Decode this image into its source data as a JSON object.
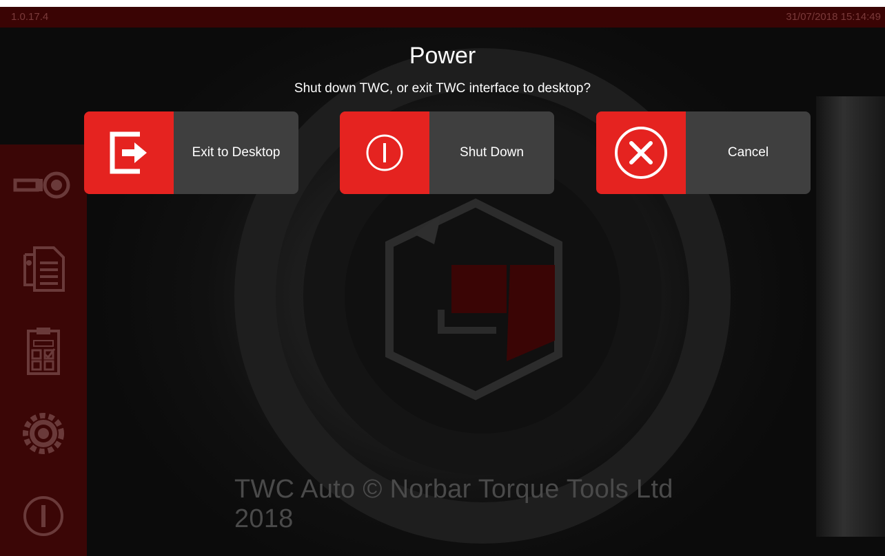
{
  "status_bar": {
    "version": "1.0.17.4",
    "datetime": "31/07/2018 15:14:49"
  },
  "sidebar": {
    "items": [
      {
        "icon": "wrench-tool-icon"
      },
      {
        "icon": "documents-icon"
      },
      {
        "icon": "jobs-clipboard-icon"
      },
      {
        "icon": "settings-gear-icon"
      },
      {
        "icon": "power-icon"
      }
    ]
  },
  "dialog": {
    "title": "Power",
    "subtitle": "Shut down TWC, or exit TWC interface to desktop?",
    "buttons": [
      {
        "label": "Exit to Desktop",
        "icon": "exit-icon"
      },
      {
        "label": "Shut Down",
        "icon": "power-icon"
      },
      {
        "label": "Cancel",
        "icon": "cancel-icon"
      }
    ]
  },
  "footer": {
    "copyright": "TWC Auto © Norbar Torque Tools Ltd 2018"
  },
  "colors": {
    "accent": "#e52320",
    "sidebar": "#3b0606",
    "button_bg": "#3f3f3f"
  }
}
